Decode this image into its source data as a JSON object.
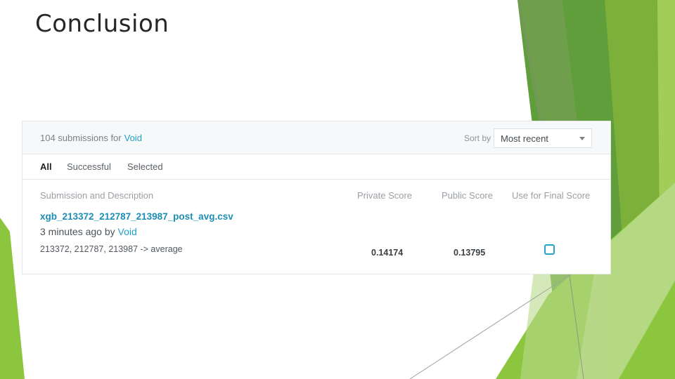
{
  "slide": {
    "title": "Conclusion"
  },
  "theme": {
    "green_dark": "#5f9e3a",
    "green_light": "#8cc63f",
    "link": "#20a0c6"
  },
  "panel": {
    "count_prefix": "104 submissions for",
    "owner": "Void",
    "sort_label": "Sort by",
    "sort_value": "Most recent",
    "tabs": [
      {
        "label": "All",
        "active": true
      },
      {
        "label": "Successful",
        "active": false
      },
      {
        "label": "Selected",
        "active": false
      }
    ],
    "columns": {
      "submission": "Submission and Description",
      "private": "Private Score",
      "public": "Public Score",
      "final": "Use for Final Score"
    },
    "rows": [
      {
        "file": "xgb_213372_212787_213987_post_avg.csv",
        "time_prefix": "3 minutes ago by",
        "author": "Void",
        "description": "213372, 212787, 213987 -> average",
        "private_score": "0.14174",
        "public_score": "0.13795",
        "use_for_final": false
      }
    ]
  }
}
